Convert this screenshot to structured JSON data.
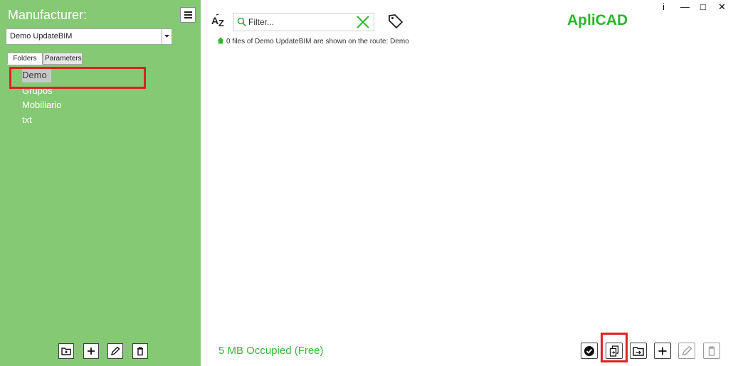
{
  "sidebar": {
    "title": "Manufacturer:",
    "menu_icon": "hamburger-menu-icon",
    "manufacturer_select": {
      "value": "Demo UpdateBIM"
    },
    "tabs": [
      {
        "label": "Folders",
        "active": true
      },
      {
        "label": "Parameters",
        "active": false
      }
    ],
    "folders": [
      {
        "label": "Demo",
        "selected": true
      },
      {
        "label": "Grupos",
        "selected": false
      },
      {
        "label": "Mobiliario",
        "selected": false
      },
      {
        "label": "txt",
        "selected": false
      }
    ],
    "footer_buttons": [
      {
        "icon": "new-folder-icon"
      },
      {
        "icon": "plus-icon"
      },
      {
        "icon": "pencil-icon"
      },
      {
        "icon": "trash-icon"
      }
    ]
  },
  "toolbar": {
    "sort_icon": "sort-az-icon",
    "filter": {
      "placeholder": "Filter...",
      "value": ""
    },
    "clear_icon": "clear-x-icon",
    "tag_icon": "tag-icon"
  },
  "brand": {
    "name": "ApliCAD",
    "color": "#2cb52c"
  },
  "window_controls": {
    "info": "i",
    "minimize": "—",
    "maximize": "□",
    "close": "✕"
  },
  "route_message": "0 files of Demo UpdateBIM are shown on the route: Demo",
  "status": "5 MB Occupied (Free)",
  "action_buttons": [
    {
      "icon": "check-circle-icon",
      "enabled": true
    },
    {
      "icon": "copy-files-icon",
      "enabled": true,
      "highlighted": true
    },
    {
      "icon": "move-to-folder-icon",
      "enabled": true
    },
    {
      "icon": "plus-icon",
      "enabled": true
    },
    {
      "icon": "pencil-icon",
      "enabled": false
    },
    {
      "icon": "trash-icon",
      "enabled": false
    }
  ],
  "colors": {
    "sidebar": "#85c975",
    "accent": "#2cb52c",
    "highlight": "#e02020"
  }
}
